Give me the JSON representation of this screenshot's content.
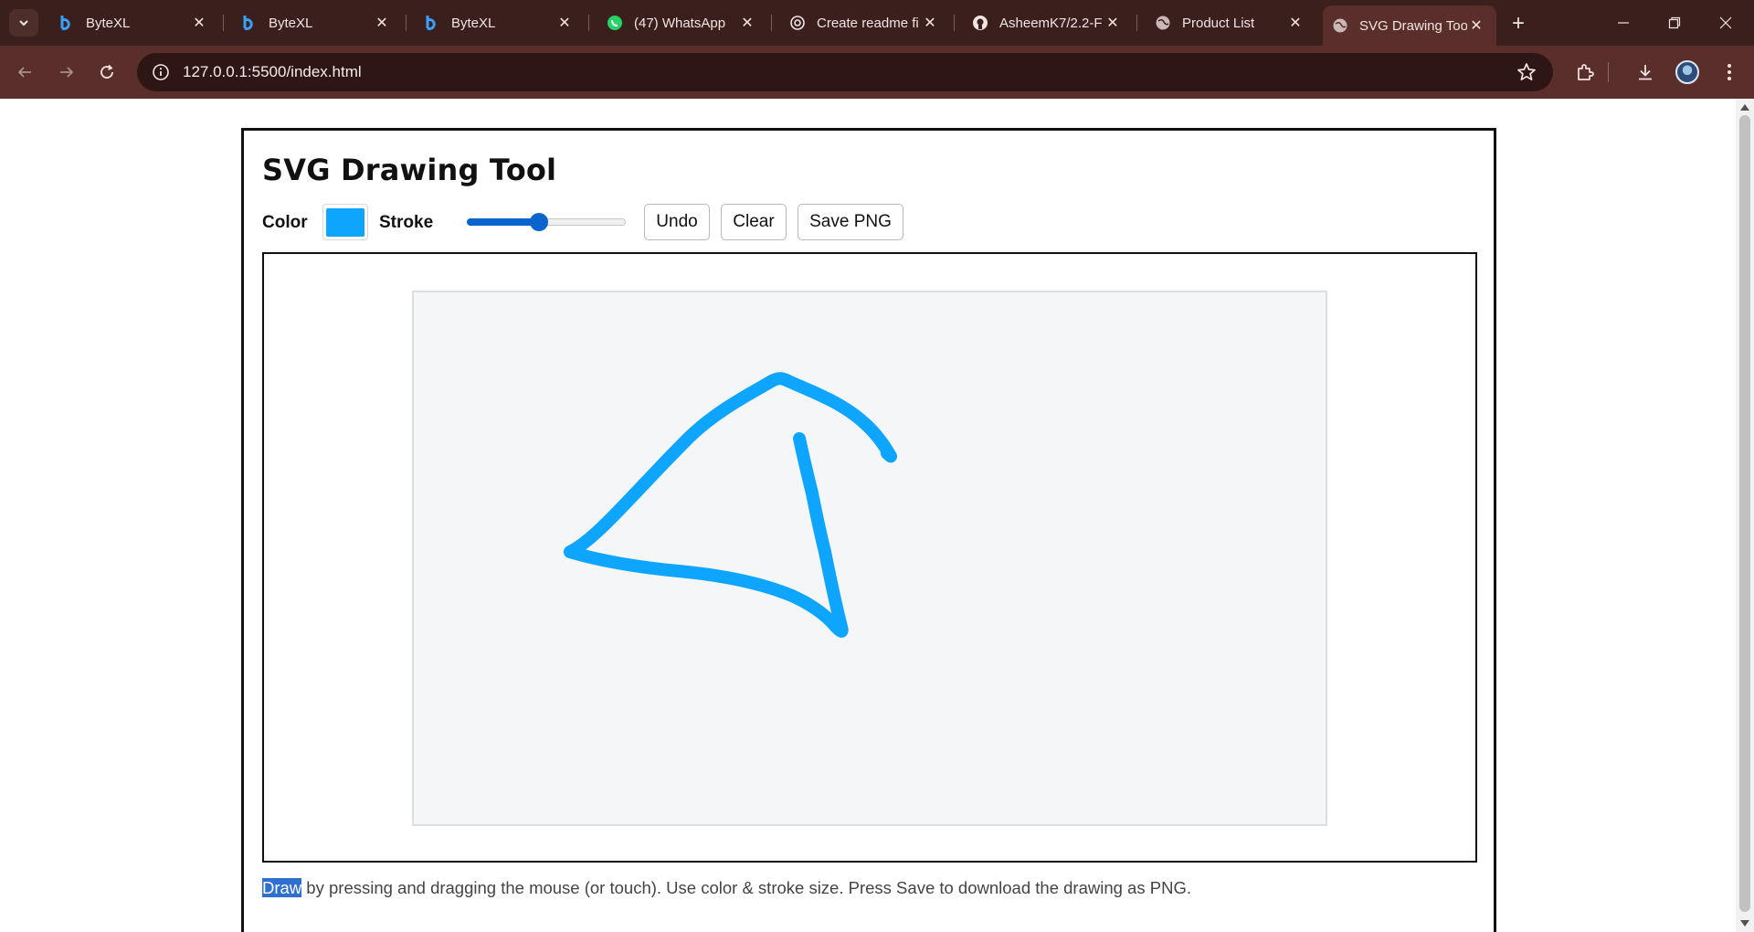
{
  "browser": {
    "tabs": [
      {
        "title": "ByteXL",
        "icon": "bytexl-icon"
      },
      {
        "title": "ByteXL",
        "icon": "bytexl-icon"
      },
      {
        "title": "ByteXL",
        "icon": "bytexl-icon"
      },
      {
        "title": "(47) WhatsApp",
        "icon": "whatsapp-icon"
      },
      {
        "title": "Create readme fi",
        "icon": "chatgpt-icon"
      },
      {
        "title": "AsheemK7/2.2-F",
        "icon": "github-icon"
      },
      {
        "title": "Product List",
        "icon": "globe-icon"
      },
      {
        "title": "SVG Drawing Too",
        "icon": "globe-icon",
        "active": true
      }
    ],
    "url": "127.0.0.1:5500/index.html"
  },
  "app": {
    "title": "SVG Drawing Tool",
    "color_label": "Color",
    "stroke_label": "Stroke",
    "stroke_value": 0.45,
    "undo_label": "Undo",
    "clear_label": "Clear",
    "save_label": "Save PNG",
    "help_highlight": "Draw",
    "help_text": " by pressing and dragging the mouse (or touch). Use color & stroke size. Press Save to download the drawing as PNG.",
    "stroke_color": "#0ea5ff"
  },
  "colors": {
    "chrome_dark": "#3b1f1d",
    "chrome_toolbar": "#5a2e2b",
    "accent": "#0b63ce",
    "canvas_bg": "#f5f6f8"
  }
}
